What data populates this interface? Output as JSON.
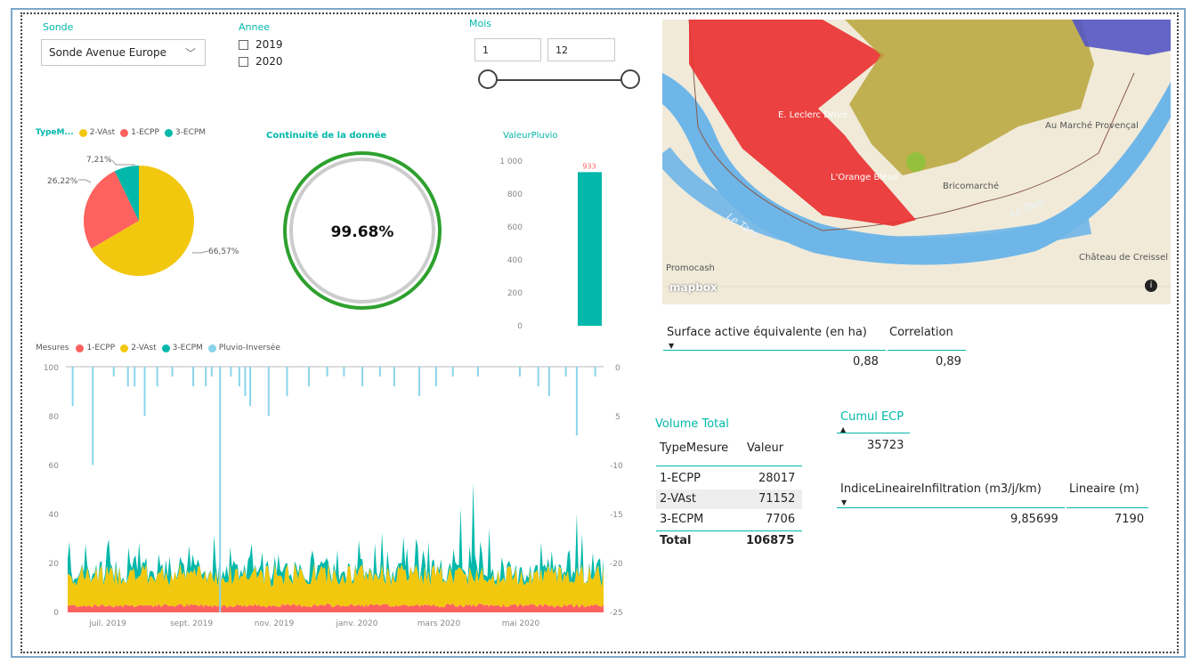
{
  "filters": {
    "sonde": {
      "title": "Sonde",
      "value": "Sonde Avenue Europe"
    },
    "annee": {
      "title": "Annee",
      "options": [
        "2019",
        "2020"
      ]
    },
    "mois": {
      "title": "Mois",
      "min": "1",
      "max": "12"
    }
  },
  "pie": {
    "legend_title": "TypeM...",
    "legend": [
      "2-VAst",
      "1-ECPP",
      "3-ECPM"
    ],
    "labels": {
      "vast": "66,57%",
      "ecpp": "26,22%",
      "ecpm": "7,21%"
    }
  },
  "gauge": {
    "title": "Continuité de la donnée",
    "value": "99.68%"
  },
  "pluvio": {
    "title": "ValeurPluvio",
    "ticks": [
      "1 000",
      "800",
      "600",
      "400",
      "200",
      "0"
    ],
    "bar_label": "933"
  },
  "mesures": {
    "legend_title": "Mesures",
    "legend": [
      "1-ECPP",
      "2-VAst",
      "3-ECPM",
      "Pluvio-Inversée"
    ],
    "y_ticks": [
      "100",
      "80",
      "60",
      "40",
      "20",
      "0"
    ],
    "y2_ticks": [
      "0",
      "5",
      "-10",
      "-15",
      "-20",
      "-25"
    ],
    "x_ticks": [
      "juil. 2019",
      "sept. 2019",
      "nov. 2019",
      "janv. 2020",
      "mars 2020",
      "mai 2020"
    ]
  },
  "map": {
    "labels": [
      "E. Leclerc Drive",
      "L'Orange Bleue",
      "Bricomarché",
      "Au Marché Provençal",
      "Promocash",
      "Château de Creissel",
      "Le Tarn",
      "Le Tarn"
    ],
    "logo": "mapbox",
    "info_icon": "info-icon"
  },
  "surface": {
    "col1": "Surface active équivalente (en ha)",
    "col2": "Correlation",
    "val1": "0,88",
    "val2": "0,89"
  },
  "volume": {
    "title": "Volume Total",
    "headers": [
      "TypeMesure",
      "Valeur"
    ],
    "rows": [
      {
        "type": "1-ECPP",
        "value": "28017"
      },
      {
        "type": "2-VAst",
        "value": "71152"
      },
      {
        "type": "3-ECPM",
        "value": "7706"
      }
    ],
    "total_label": "Total",
    "total_value": "106875"
  },
  "cumul": {
    "title": "Cumul ECP",
    "value": "35723"
  },
  "indice": {
    "col1": "IndiceLineaireInfiltration (m3/j/km)",
    "col2": "Lineaire (m)",
    "val1": "9,85699",
    "val2": "7190"
  },
  "colors": {
    "teal": "#01b8aa",
    "red": "#fd625e",
    "yellow": "#f2c80f",
    "lightblue": "#8ad4eb",
    "gauge_ring": "#2ea02e"
  },
  "chart_data": [
    {
      "type": "pie",
      "categories": [
        "2-VAst",
        "1-ECPP",
        "3-ECPM"
      ],
      "values": [
        66.57,
        26.22,
        7.21
      ]
    },
    {
      "type": "bar",
      "title": "ValeurPluvio",
      "categories": [
        ""
      ],
      "values": [
        933
      ],
      "ylim": [
        0,
        1000
      ]
    },
    {
      "type": "area",
      "title": "",
      "series": [
        {
          "name": "1-ECPP",
          "approx_level": 2
        },
        {
          "name": "2-VAst",
          "approx_level": 15
        },
        {
          "name": "3-ECPM",
          "approx_level": 18
        },
        {
          "name": "Pluvio-Inversée",
          "approx_level": 0
        }
      ],
      "x_range": [
        "juil. 2019",
        "mai 2020"
      ],
      "ylim": [
        0,
        100
      ],
      "y2lim": [
        -25,
        0
      ]
    }
  ]
}
